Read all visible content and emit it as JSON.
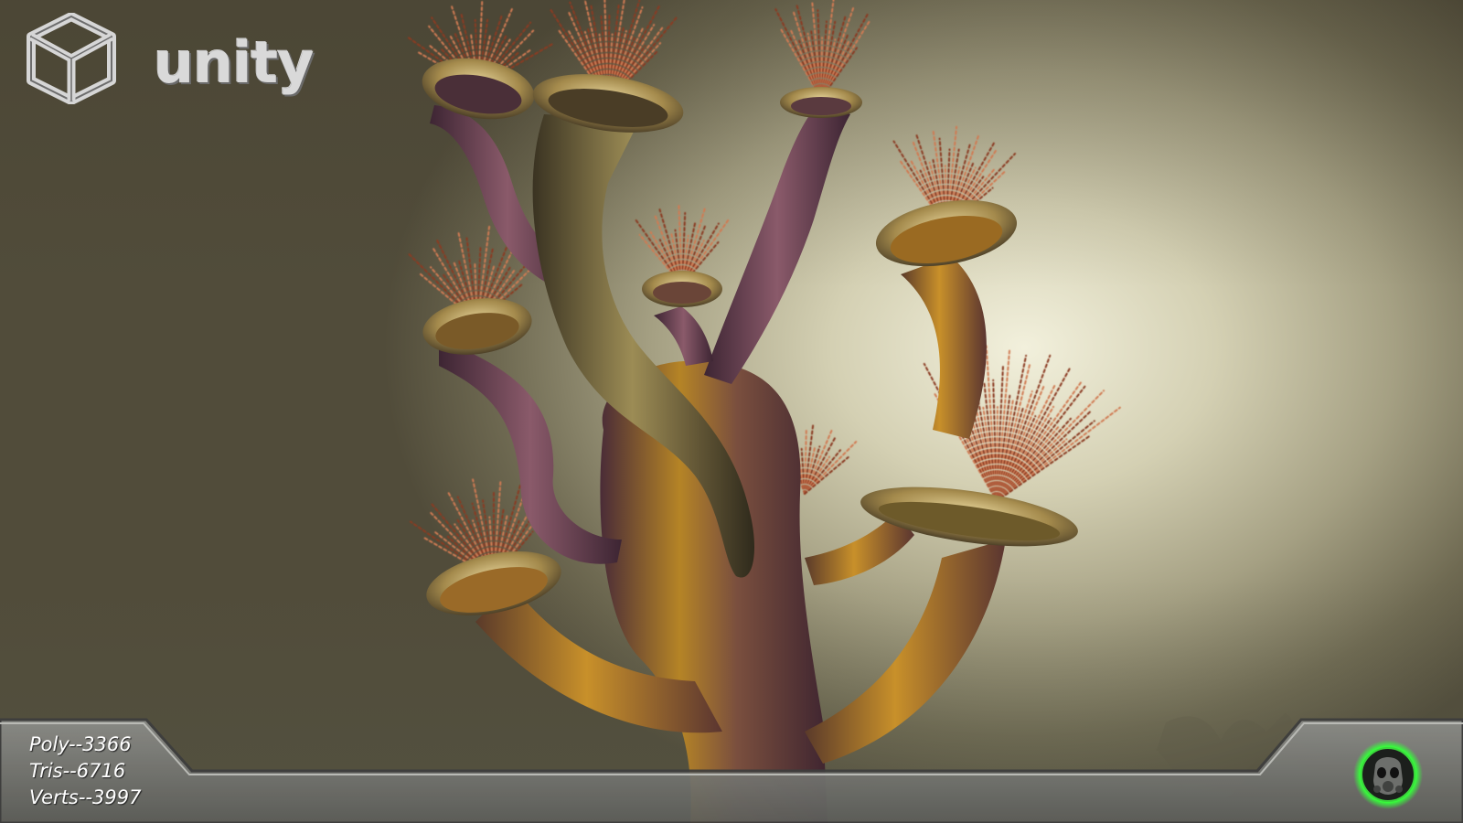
{
  "brand": {
    "logo_text": "unity",
    "logo_icon": "unity-cube-icon"
  },
  "stats": {
    "poly": "Poly--3366",
    "tris": "Tris--6716",
    "verts": "Verts--3997"
  },
  "badge": {
    "icon": "gasmask-icon",
    "glow_color": "#35ff3a"
  },
  "colors": {
    "background_light": "#f2f0dc",
    "background_dark": "#514c3a",
    "bar_fill": "#6f706c"
  }
}
